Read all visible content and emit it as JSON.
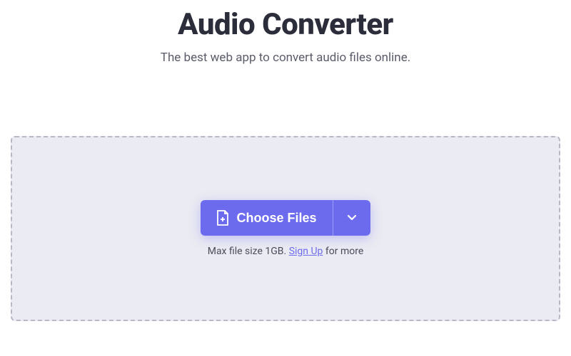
{
  "header": {
    "title": "Audio Converter",
    "subtitle": "The best web app to convert audio files online."
  },
  "dropzone": {
    "choose_files_label": "Choose Files",
    "hint_prefix": "Max file size 1GB. ",
    "signup_label": "Sign Up",
    "hint_suffix": " for more"
  },
  "colors": {
    "accent": "#6d6bed",
    "text_dark": "#2b2d3a",
    "text_muted": "#5a5c6a",
    "dropzone_bg": "#ebebf3",
    "dropzone_border": "#b8b8c7"
  }
}
